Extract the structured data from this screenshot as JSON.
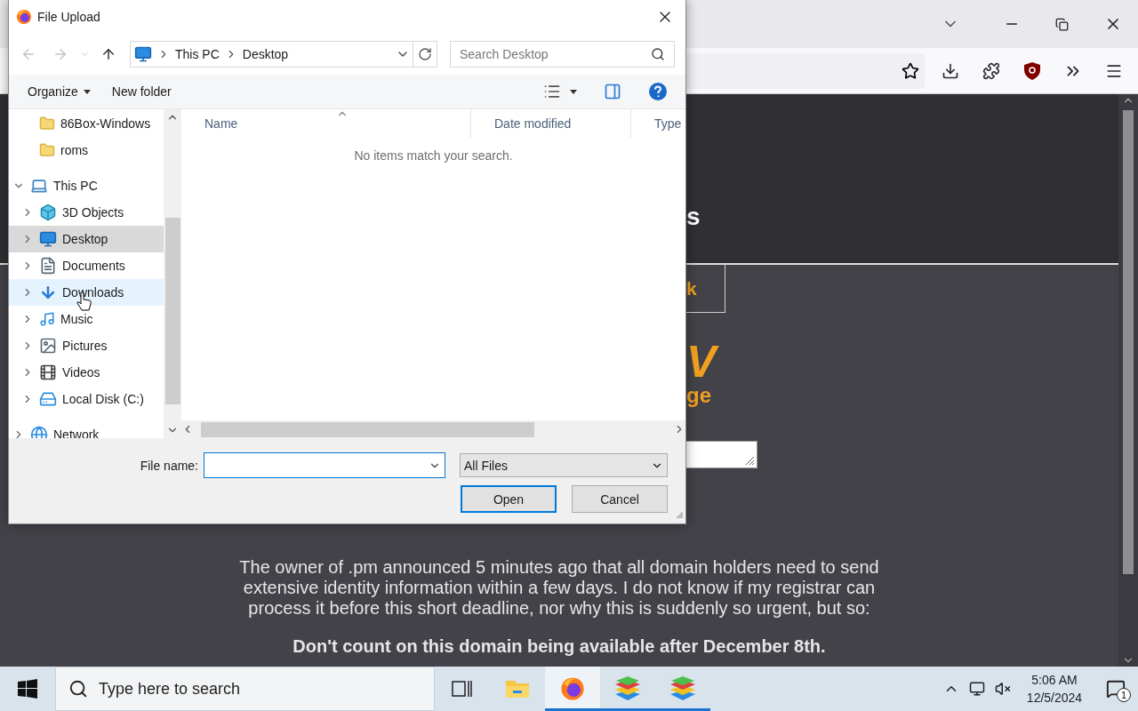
{
  "dialog": {
    "title": "File Upload",
    "nav": {
      "back": {
        "disabled": true
      },
      "forward": {
        "disabled": true
      },
      "breadcrumbs": [
        "This PC",
        "Desktop"
      ],
      "search": {
        "placeholder": "Search Desktop"
      }
    },
    "commands": [
      {
        "label": "Organize",
        "menu": true
      },
      {
        "label": "New folder",
        "menu": false
      }
    ],
    "nav_pane": {
      "partial_items": [
        {
          "label": "86Box-Windows",
          "kind": "folder"
        },
        {
          "label": "roms",
          "kind": "folder"
        }
      ],
      "items": [
        {
          "label": "This PC",
          "kind": "pc",
          "expanded": true,
          "selected": false,
          "hovered": false,
          "children": [
            {
              "label": "3D Objects",
              "kind": "cube",
              "expanded": false,
              "selected": false,
              "hovered": false
            },
            {
              "label": "Desktop",
              "kind": "desktop",
              "expanded": false,
              "selected": true,
              "hovered": false
            },
            {
              "label": "Documents",
              "kind": "documents",
              "expanded": false,
              "selected": false,
              "hovered": false
            },
            {
              "label": "Downloads",
              "kind": "downloads",
              "expanded": false,
              "selected": false,
              "hovered": true
            },
            {
              "label": "Music",
              "kind": "music",
              "expanded": false,
              "selected": false,
              "hovered": false
            },
            {
              "label": "Pictures",
              "kind": "pictures",
              "expanded": false,
              "selected": false,
              "hovered": false
            },
            {
              "label": "Videos",
              "kind": "videos",
              "expanded": false,
              "selected": false,
              "hovered": false
            },
            {
              "label": "Local Disk (C:)",
              "kind": "disk",
              "expanded": false,
              "selected": false,
              "hovered": false
            }
          ]
        },
        {
          "label": "Network",
          "kind": "network",
          "expanded": false,
          "selected": false,
          "hovered": false
        }
      ]
    },
    "columns": [
      {
        "label": "Name",
        "sorted": true
      },
      {
        "label": "Date modified",
        "sorted": false
      },
      {
        "label": "Type",
        "sorted": false
      }
    ],
    "empty_message": "No items match your search.",
    "file_name_label": "File name:",
    "file_type": "All Files",
    "buttons": [
      {
        "label": "Open",
        "default": true
      },
      {
        "label": "Cancel",
        "default": false
      }
    ]
  },
  "page": {
    "heading_fragment": "s",
    "link_fragment": "k",
    "title_fragment": "V",
    "subtitle_fragment": "ge",
    "notice": "The owner of .pm announced 5 minutes ago that all domain holders need to send extensive identity information within a few days. I do not know if my registrar can process it before this short deadline, nor why this is suddenly so urgent, but so:",
    "warning": "Don't count on this domain being available after December 8th."
  },
  "taskbar": {
    "search_placeholder": "Type here to search",
    "apps": [
      {
        "kind": "task-view",
        "running": false,
        "selected": false
      },
      {
        "kind": "explorer",
        "running": false,
        "selected": false
      },
      {
        "kind": "firefox",
        "running": true,
        "selected": true
      },
      {
        "kind": "stack",
        "running": true,
        "selected": false
      },
      {
        "kind": "stack",
        "running": true,
        "selected": false
      }
    ],
    "clock": {
      "time": "5:06 AM",
      "date": "12/5/2024"
    },
    "notifications": "1"
  }
}
